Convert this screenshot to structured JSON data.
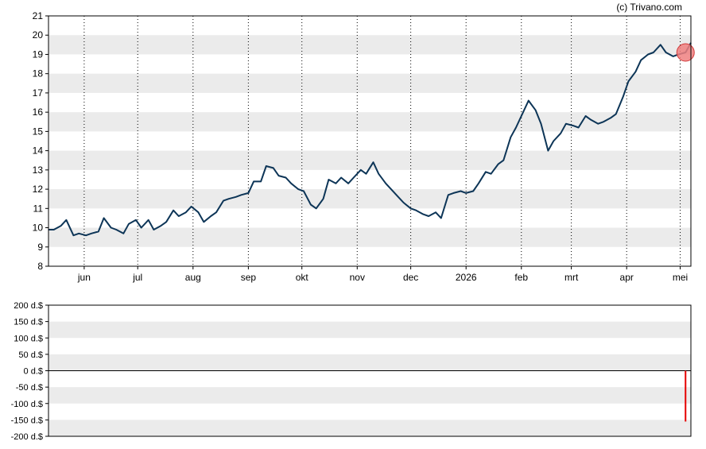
{
  "copyright": "(c) Trivano.com",
  "colors": {
    "band": "#ebebeb",
    "price_line": "#0d3557",
    "marker_fill": "#f08080",
    "marker_stroke": "#d23c3c",
    "volume_bar": "#e60000",
    "axis": "#000000"
  },
  "chart_data": [
    {
      "type": "line",
      "title": "",
      "xlabel": "",
      "ylabel": "",
      "ylim": [
        8,
        21
      ],
      "y_ticks": [
        "8",
        "9",
        "10",
        "11",
        "12",
        "13",
        "14",
        "15",
        "16",
        "17",
        "18",
        "19",
        "20",
        "21"
      ],
      "x_range": [
        "2025-05-12",
        "2026-05-07"
      ],
      "x_ticks": [
        {
          "date": "2025-06-01",
          "label": "jun"
        },
        {
          "date": "2025-07-01",
          "label": "jul"
        },
        {
          "date": "2025-08-01",
          "label": "aug"
        },
        {
          "date": "2025-09-01",
          "label": "sep"
        },
        {
          "date": "2025-10-01",
          "label": "okt"
        },
        {
          "date": "2025-11-01",
          "label": "nov"
        },
        {
          "date": "2025-12-01",
          "label": "dec"
        },
        {
          "date": "2026-01-01",
          "label": "2026"
        },
        {
          "date": "2026-02-01",
          "label": "feb"
        },
        {
          "date": "2026-03-01",
          "label": "mrt"
        },
        {
          "date": "2026-04-01",
          "label": "apr"
        },
        {
          "date": "2026-05-01",
          "label": "mei"
        }
      ],
      "grid": "alternating horizontal bands, dotted vertical lines at month starts",
      "series": [
        {
          "x": [
            "2025-05-12",
            "2025-05-15",
            "2025-05-19",
            "2025-05-22",
            "2025-05-26",
            "2025-05-29",
            "2025-06-02",
            "2025-06-05",
            "2025-06-09",
            "2025-06-12",
            "2025-06-16",
            "2025-06-19",
            "2025-06-23",
            "2025-06-26",
            "2025-06-30",
            "2025-07-03",
            "2025-07-07",
            "2025-07-10",
            "2025-07-14",
            "2025-07-17",
            "2025-07-21",
            "2025-07-24",
            "2025-07-28",
            "2025-07-31",
            "2025-08-04",
            "2025-08-07",
            "2025-08-11",
            "2025-08-14",
            "2025-08-18",
            "2025-08-21",
            "2025-08-25",
            "2025-08-28",
            "2025-09-01",
            "2025-09-04",
            "2025-09-08",
            "2025-09-11",
            "2025-09-15",
            "2025-09-18",
            "2025-09-22",
            "2025-09-25",
            "2025-09-29",
            "2025-10-02",
            "2025-10-06",
            "2025-10-09",
            "2025-10-13",
            "2025-10-16",
            "2025-10-20",
            "2025-10-23",
            "2025-10-27",
            "2025-10-30",
            "2025-11-03",
            "2025-11-06",
            "2025-11-10",
            "2025-11-13",
            "2025-11-17",
            "2025-11-20",
            "2025-11-24",
            "2025-11-27",
            "2025-12-01",
            "2025-12-04",
            "2025-12-08",
            "2025-12-11",
            "2025-12-15",
            "2025-12-18",
            "2025-12-22",
            "2025-12-25",
            "2025-12-29",
            "2026-01-01",
            "2026-01-05",
            "2026-01-08",
            "2026-01-12",
            "2026-01-15",
            "2026-01-19",
            "2026-01-22",
            "2026-01-26",
            "2026-01-29",
            "2026-02-02",
            "2026-02-05",
            "2026-02-09",
            "2026-02-12",
            "2026-02-16",
            "2026-02-19",
            "2026-02-23",
            "2026-02-26",
            "2026-03-02",
            "2026-03-05",
            "2026-03-09",
            "2026-03-12",
            "2026-03-16",
            "2026-03-19",
            "2026-03-23",
            "2026-03-26",
            "2026-03-30",
            "2026-04-02",
            "2026-04-06",
            "2026-04-09",
            "2026-04-13",
            "2026-04-16",
            "2026-04-20",
            "2026-04-23",
            "2026-04-27",
            "2026-04-30",
            "2026-05-04",
            "2026-05-07"
          ],
          "values": [
            9.9,
            9.9,
            10.1,
            10.4,
            9.6,
            9.7,
            9.6,
            9.7,
            9.8,
            10.5,
            10.0,
            9.9,
            9.7,
            10.2,
            10.4,
            10.0,
            10.4,
            9.9,
            10.1,
            10.3,
            10.9,
            10.6,
            10.8,
            11.1,
            10.8,
            10.3,
            10.6,
            10.8,
            11.4,
            11.5,
            11.6,
            11.7,
            11.8,
            12.4,
            12.4,
            13.2,
            13.1,
            12.7,
            12.6,
            12.3,
            12.0,
            11.9,
            11.2,
            11.0,
            11.5,
            12.5,
            12.3,
            12.6,
            12.3,
            12.6,
            13.0,
            12.8,
            13.4,
            12.8,
            12.3,
            12.0,
            11.6,
            11.3,
            11.0,
            10.9,
            10.7,
            10.6,
            10.8,
            10.5,
            11.7,
            11.8,
            11.9,
            11.8,
            11.9,
            12.3,
            12.9,
            12.8,
            13.3,
            13.5,
            14.7,
            15.2,
            16.0,
            16.6,
            16.1,
            15.4,
            14.0,
            14.5,
            14.9,
            15.4,
            15.3,
            15.2,
            15.8,
            15.6,
            15.4,
            15.5,
            15.7,
            15.9,
            16.8,
            17.6,
            18.1,
            18.7,
            19.0,
            19.1,
            19.5,
            19.1,
            18.9,
            19.0,
            19.1,
            19.6
          ],
          "marker": {
            "date": "2026-05-04",
            "value": 19.1
          }
        }
      ]
    },
    {
      "type": "bar",
      "title": "",
      "xlabel": "",
      "ylabel": "",
      "ylim": [
        -200,
        200
      ],
      "y_ticks": [
        "200 d.$",
        "150 d.$",
        "100 d.$",
        "50 d.$",
        "0 d.$",
        "-50 d.$",
        "-100 d.$",
        "-150 d.$",
        "-200 d.$"
      ],
      "grid": "alternating horizontal bands",
      "series": [
        {
          "x": [
            "2026-05-04"
          ],
          "values": [
            -155
          ]
        }
      ]
    }
  ]
}
